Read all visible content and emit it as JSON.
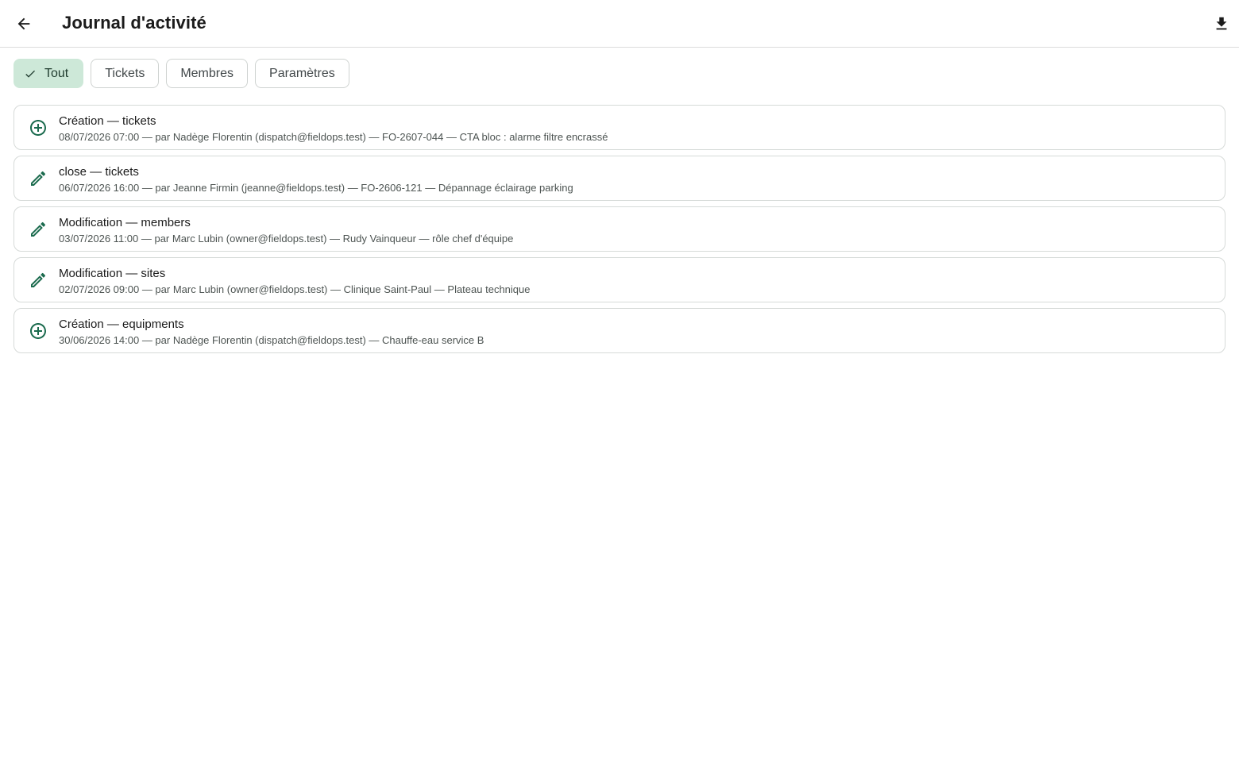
{
  "header": {
    "title": "Journal d'activité",
    "back_icon": "arrow-left-icon",
    "download_icon": "download-icon"
  },
  "filters": {
    "selected": "Tout",
    "chips": [
      {
        "label": "Tout",
        "selected": true
      },
      {
        "label": "Tickets",
        "selected": false
      },
      {
        "label": "Membres",
        "selected": false
      },
      {
        "label": "Paramètres",
        "selected": false
      }
    ]
  },
  "accent_color": "#1b6b4e",
  "chip_selected_bg": "#cde8d8",
  "entries": [
    {
      "icon": "add-circle-icon",
      "title": "Création — tickets",
      "subtitle": "08/07/2026 07:00 — par Nadège Florentin (dispatch@fieldops.test) — FO-2607-044 — CTA bloc : alarme filtre encrassé"
    },
    {
      "icon": "pencil-icon",
      "title": "close — tickets",
      "subtitle": "06/07/2026 16:00 — par Jeanne Firmin (jeanne@fieldops.test) — FO-2606-121 — Dépannage éclairage parking"
    },
    {
      "icon": "pencil-icon",
      "title": "Modification — members",
      "subtitle": "03/07/2026 11:00 — par Marc Lubin (owner@fieldops.test) — Rudy Vainqueur — rôle chef d'équipe"
    },
    {
      "icon": "pencil-icon",
      "title": "Modification — sites",
      "subtitle": "02/07/2026 09:00 — par Marc Lubin (owner@fieldops.test) — Clinique Saint-Paul — Plateau technique"
    },
    {
      "icon": "add-circle-icon",
      "title": "Création — equipments",
      "subtitle": "30/06/2026 14:00 — par Nadège Florentin (dispatch@fieldops.test) — Chauffe-eau service B"
    }
  ]
}
